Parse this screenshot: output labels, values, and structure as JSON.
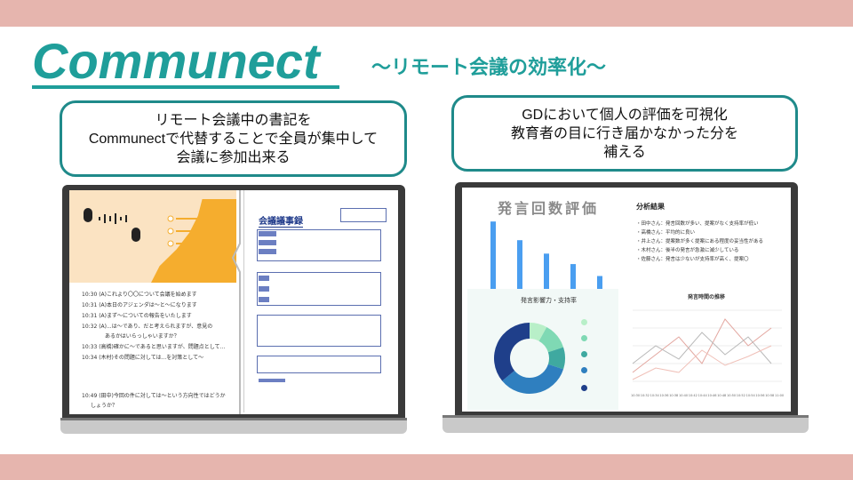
{
  "header": {
    "logo": "Communect",
    "subtitle": "〜リモート会議の効率化〜"
  },
  "callouts": {
    "left": {
      "lines": [
        "リモート会議中の書記を",
        "Communectで代替することで全員が集中して",
        "会議に参加出来る"
      ]
    },
    "right": {
      "lines": [
        "GDにおいて個人の評価を可視化",
        "教育者の目に行き届かなかった分を",
        "補える"
      ]
    }
  },
  "left_screen": {
    "doc_title": "会議議事録",
    "log": [
      "10:30 (A)これより〇〇について会議を始めます",
      "10:31 (A)本日のアジェンダは〜と〜になります",
      "10:31 (A)まず〜についての報告をいたします",
      "10:32 (A)...は〜であり、だと考えられますが、意見の",
      "あるかはいらっしゃいますか？",
      "10:33 (高橋)確かに〜であると思いますが、問題点として...",
      "10:34 (木村)その問題に対しては...を対策として〜",
      "10:49 (田中)今回の件に対しては〜という方向性ではどうか",
      "しょうか？"
    ]
  },
  "right_screen": {
    "chart_title": "発言回数評価",
    "analysis_title": "分析結果",
    "analysis_lines": [
      "・田中さん：発言回数が多い、提案がなく支持率が低い",
      "・高橋さん：平均的に良い",
      "・井上さん：提案数が多く提案にある程度の妥当性がある",
      "・木村さん：後半の発言が急激に減少している",
      "・佐藤さん：発言は少ないが支持率が高く、提案〇"
    ],
    "donut_title": "発言影響力・支持率",
    "line_title": "発言時間の推移",
    "line_x_labels": [
      "10:30",
      "10:32",
      "10:34",
      "10:36",
      "10:38",
      "10:40",
      "10:42",
      "10:44",
      "10:46",
      "10:48",
      "10:50",
      "10:52",
      "10:54",
      "10:56",
      "10:58",
      "11:00"
    ],
    "bar_values": [
      95,
      70,
      52,
      38,
      22
    ],
    "bar_color": "#4a9ef0",
    "donut_values": [
      8,
      12,
      10,
      34,
      36
    ],
    "donut_colors": [
      "#b8efc8",
      "#7fd9b4",
      "#3fa9a0",
      "#2f7fbf",
      "#1f3f8a"
    ]
  },
  "colors": {
    "band": "#e6b5ae",
    "accent": "#1f9e9a",
    "callout_border": "#1f8a8a"
  }
}
